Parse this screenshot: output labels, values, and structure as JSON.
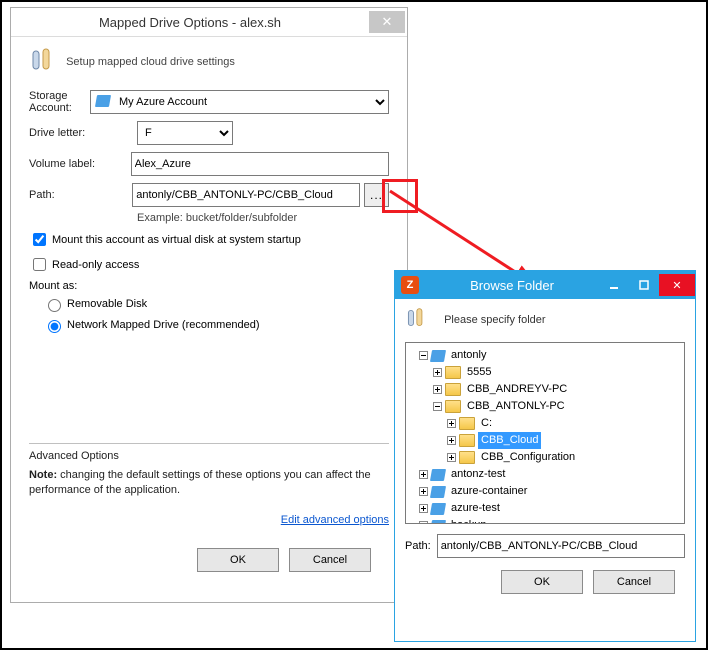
{
  "dlg1": {
    "title": "Mapped Drive Options - alex.sh",
    "subtitle": "Setup mapped cloud drive settings",
    "labels": {
      "storage_account": "Storage Account:",
      "drive_letter": "Drive letter:",
      "volume_label": "Volume label:",
      "path": "Path:"
    },
    "storage_account_value": "My Azure Account",
    "drive_letter_value": "F",
    "volume_label_value": "Alex_Azure",
    "path_value": "antonly/CBB_ANTONLY-PC/CBB_Cloud",
    "browse_btn": "...",
    "example": "Example: bucket/folder/subfolder",
    "chk_mount_startup": "Mount this account as virtual disk at system startup",
    "chk_readonly": "Read-only access",
    "mount_as": "Mount as:",
    "radio_removable": "Removable Disk",
    "radio_network": "Network Mapped Drive (recommended)",
    "adv_title": "Advanced Options",
    "adv_note_strong": "Note:",
    "adv_note_rest": "  changing the default settings of these options you can affect the performance of the application.",
    "adv_link": "Edit advanced options",
    "ok": "OK",
    "cancel": "Cancel"
  },
  "dlg2": {
    "title": "Browse Folder",
    "subtitle": "Please specify folder",
    "tree": {
      "root": "antonly",
      "n_5555": "5555",
      "n_andrey": "CBB_ANDREYV-PC",
      "n_antonly_pc": "CBB_ANTONLY-PC",
      "n_c": "C:",
      "n_cbbcloud": "CBB_Cloud",
      "n_cbbconfig": "CBB_Configuration",
      "n_antonz": "antonz-test",
      "n_azurecont": "azure-container",
      "n_azuretest": "azure-test",
      "n_backup": "backup"
    },
    "path_label": "Path:",
    "path_value": "antonly/CBB_ANTONLY-PC/CBB_Cloud",
    "ok": "OK",
    "cancel": "Cancel"
  }
}
